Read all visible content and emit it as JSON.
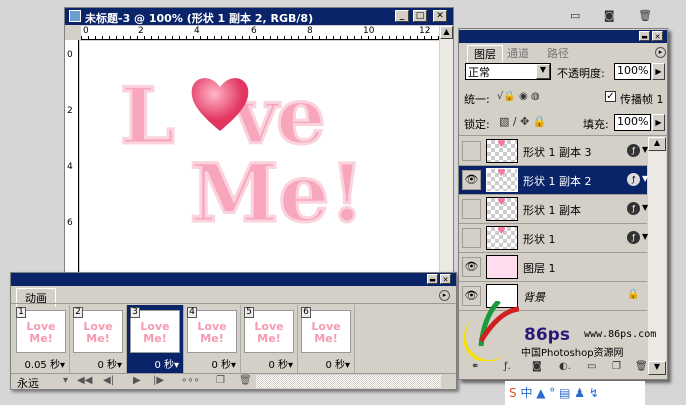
{
  "document": {
    "title": "未标题-3 @ 100% (形状 1 副本 2, RGB/8)",
    "ruler_top": [
      "0",
      "2",
      "4",
      "6",
      "8",
      "10",
      "12"
    ],
    "ruler_left": [
      "0",
      "2",
      "4",
      "6"
    ],
    "artwork_line1": "L",
    "artwork_line1b": "ve",
    "artwork_line2": "Me!"
  },
  "animation": {
    "title_tab": "动画",
    "loop": "永远",
    "frames": [
      {
        "num": "1",
        "delay": "0.05 秒▾",
        "thumb": "Love Me!"
      },
      {
        "num": "2",
        "delay": "0 秒▾",
        "thumb": "Love Me!"
      },
      {
        "num": "3",
        "delay": "0 秒▾",
        "thumb": "Love Me!"
      },
      {
        "num": "4",
        "delay": "0 秒▾",
        "thumb": "Love Me!"
      },
      {
        "num": "5",
        "delay": "0 秒▾",
        "thumb": "Love Me!"
      },
      {
        "num": "6",
        "delay": "0 秒▾",
        "thumb": "Love Me!"
      }
    ],
    "selected_frame": 3
  },
  "layers": {
    "tabs": [
      "图层",
      "通道",
      "路径"
    ],
    "blend_mode": "正常",
    "opacity_label": "不透明度:",
    "opacity": "100%",
    "unify_label": "统一:",
    "propagate_label": "传播帧 1",
    "propagate_checked": true,
    "lock_label": "锁定:",
    "fill_label": "填充:",
    "fill": "100%",
    "items": [
      {
        "name": "形状 1 副本 3",
        "visible": false,
        "fx": true
      },
      {
        "name": "形状 1 副本 2",
        "visible": true,
        "fx": true,
        "selected": true
      },
      {
        "name": "形状 1 副本",
        "visible": false,
        "fx": true
      },
      {
        "name": "形状 1",
        "visible": false,
        "fx": true
      },
      {
        "name": "图层 1",
        "visible": true,
        "fx": false
      },
      {
        "name": "背景",
        "visible": true,
        "fx": false,
        "locked": true
      }
    ]
  },
  "watermark": {
    "brand": "86ps",
    "url": "www.86ps.com",
    "site": "中国Photoshop资源网"
  },
  "colors": {
    "titlebar": "#0a246a",
    "pink": "#f59ab0",
    "heart": "#e8406a"
  }
}
